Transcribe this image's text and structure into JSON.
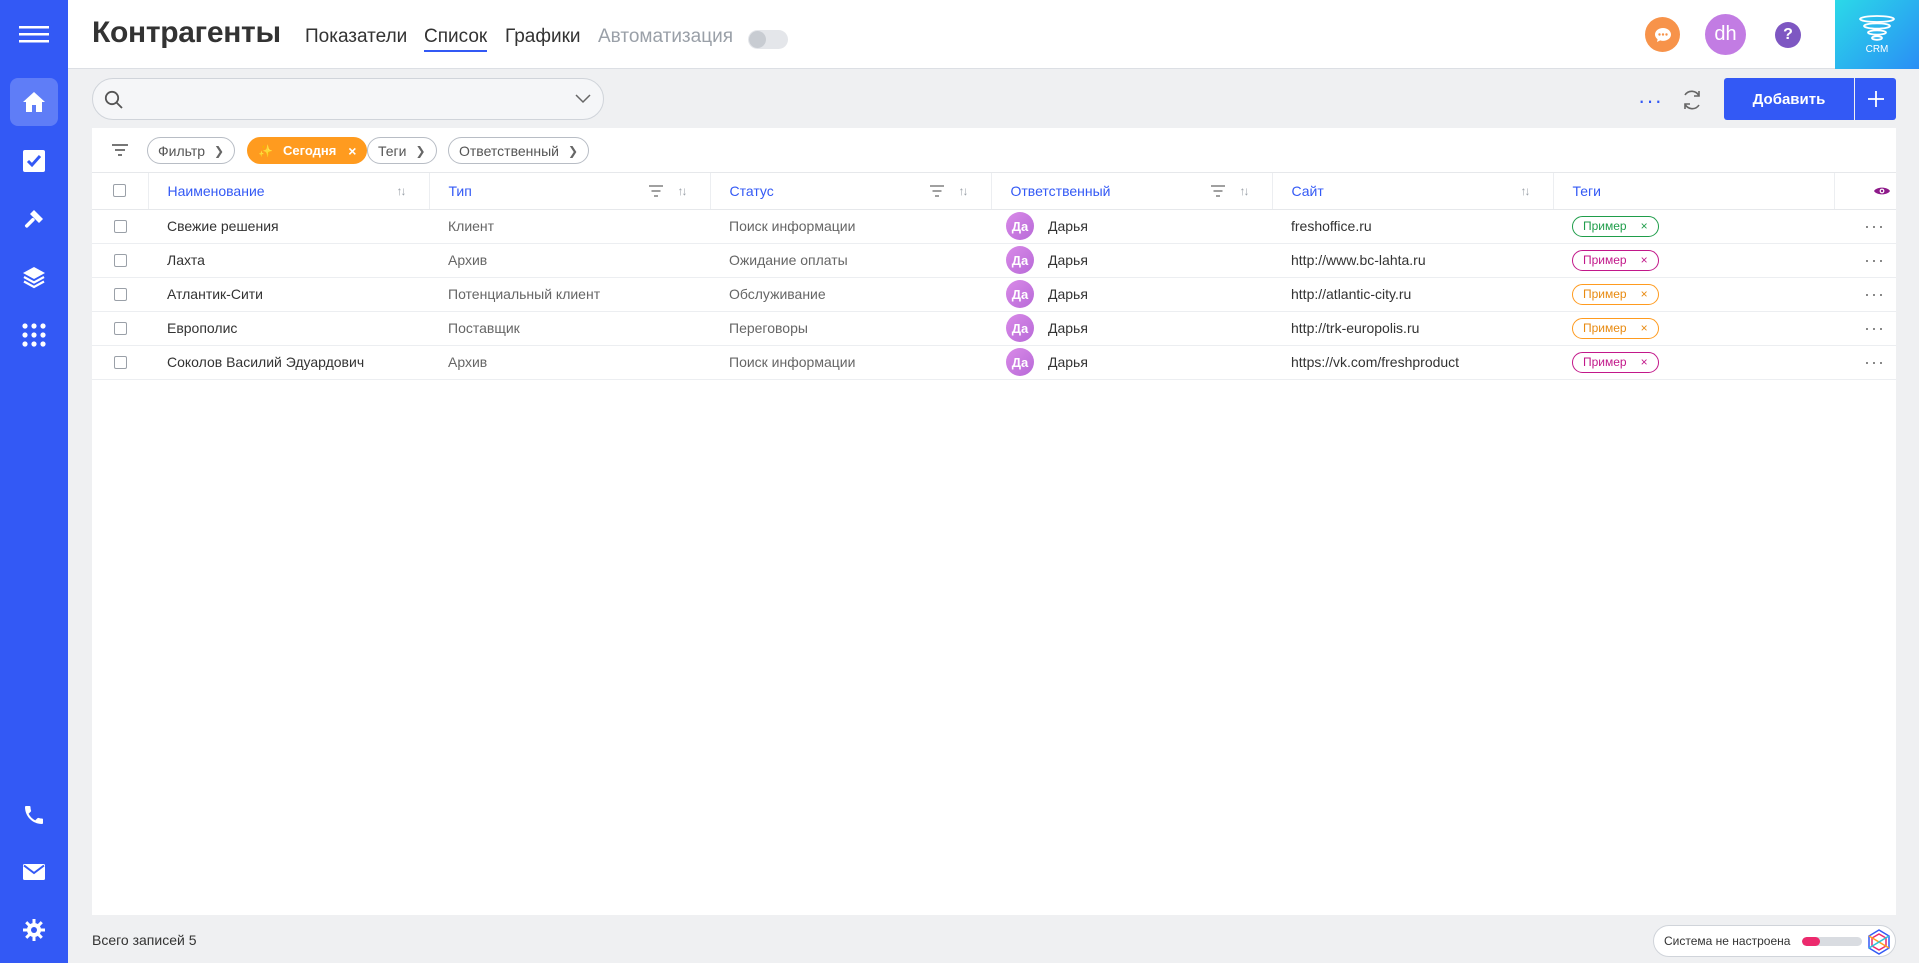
{
  "sidebar": {
    "items": [
      {
        "name": "menu-icon"
      },
      {
        "name": "home-icon"
      },
      {
        "name": "tasks-icon"
      },
      {
        "name": "hammer-icon"
      },
      {
        "name": "layers-icon"
      },
      {
        "name": "apps-grid-icon"
      },
      {
        "name": "phone-icon"
      },
      {
        "name": "mail-icon"
      },
      {
        "name": "gear-icon"
      }
    ]
  },
  "header": {
    "title": "Контрагенты",
    "tabs": [
      {
        "label": "Показатели",
        "active": false
      },
      {
        "label": "Список",
        "active": true
      },
      {
        "label": "Графики",
        "active": false
      },
      {
        "label": "Автоматизация",
        "active": false,
        "disabled": true
      }
    ],
    "avatar_initials": "dh",
    "help_label": "?",
    "logo_text": "CRM"
  },
  "toolbar": {
    "search_value": "",
    "add_label": "Добавить"
  },
  "filters": [
    {
      "label": "Фильтр"
    },
    {
      "label": "Сегодня",
      "active": true
    },
    {
      "label": "Теги"
    },
    {
      "label": "Ответственный"
    }
  ],
  "table": {
    "columns": [
      "Наименование",
      "Тип",
      "Статус",
      "Ответственный",
      "Сайт",
      "Теги"
    ],
    "rows": [
      {
        "name": "Свежие решения",
        "type": "Клиент",
        "status": "Поиск информации",
        "resp_initials": "Да",
        "resp": "Дарья",
        "site": "freshoffice.ru",
        "tag": "Пример",
        "tag_color": "#1f9d4a"
      },
      {
        "name": "Лахта",
        "type": "Архив",
        "status": "Ожидание оплаты",
        "resp_initials": "Да",
        "resp": "Дарья",
        "site": "http://www.bc-lahta.ru",
        "tag": "Пример",
        "tag_color": "#c2188a"
      },
      {
        "name": "Атлантик-Сити",
        "type": "Потенциальный клиент",
        "status": "Обслуживание",
        "resp_initials": "Да",
        "resp": "Дарья",
        "site": "http://atlantic-city.ru",
        "tag": "Пример",
        "tag_color": "#ff9b1f"
      },
      {
        "name": "Европолис",
        "type": "Поставщик",
        "status": "Переговоры",
        "resp_initials": "Да",
        "resp": "Дарья",
        "site": "http://trk-europolis.ru",
        "tag": "Пример",
        "tag_color": "#ff9b1f"
      },
      {
        "name": "Соколов Василий Эдуардович",
        "type": "Архив",
        "status": "Поиск информации",
        "resp_initials": "Да",
        "resp": "Дарья",
        "site": "https://vk.com/freshproduct",
        "tag": "Пример",
        "tag_color": "#c2188a"
      }
    ]
  },
  "footer": {
    "count_text": "Всего записей 5",
    "system_status": "Система не настроена",
    "setup_progress": 0.3
  },
  "colors": {
    "accent": "#3359f5",
    "today_chip": "#ff9b1f",
    "chat": "#f7934a",
    "avatar": "#c27ce3"
  }
}
